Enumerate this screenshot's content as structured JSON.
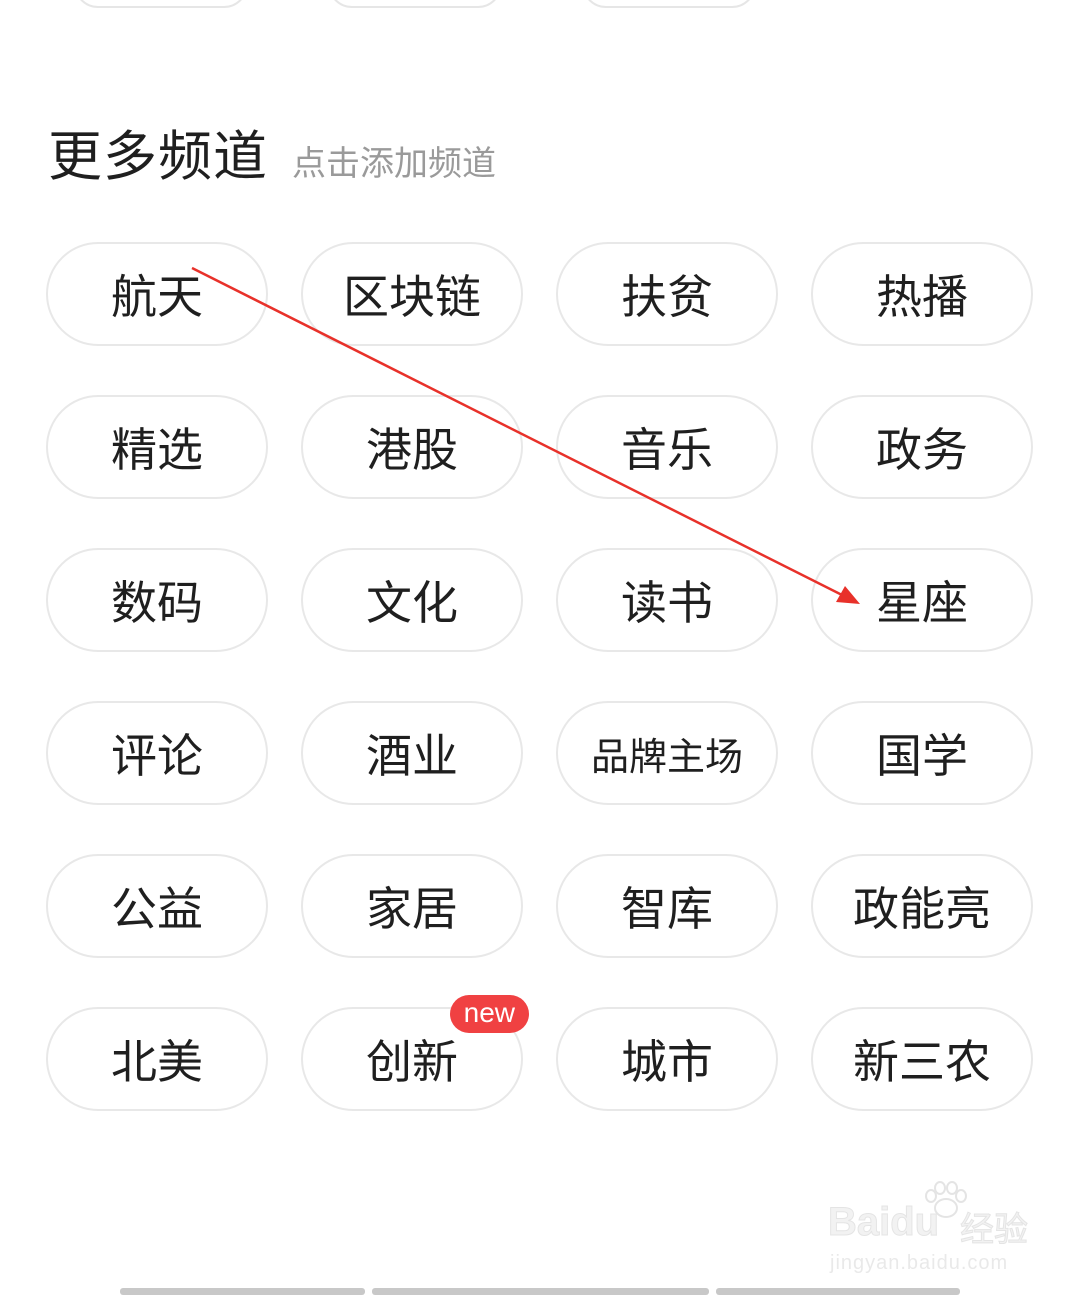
{
  "section": {
    "title": "更多频道",
    "hint": "点击添加频道"
  },
  "channels": [
    {
      "label": "航天"
    },
    {
      "label": "区块链"
    },
    {
      "label": "扶贫"
    },
    {
      "label": "热播"
    },
    {
      "label": "精选"
    },
    {
      "label": "港股"
    },
    {
      "label": "音乐"
    },
    {
      "label": "政务"
    },
    {
      "label": "数码"
    },
    {
      "label": "文化"
    },
    {
      "label": "读书"
    },
    {
      "label": "星座"
    },
    {
      "label": "评论"
    },
    {
      "label": "酒业"
    },
    {
      "label": "品牌主场"
    },
    {
      "label": "国学"
    },
    {
      "label": "公益"
    },
    {
      "label": "家居"
    },
    {
      "label": "智库"
    },
    {
      "label": "政能亮"
    },
    {
      "label": "北美"
    },
    {
      "label": "创新",
      "badge": "new"
    },
    {
      "label": "城市"
    },
    {
      "label": "新三农"
    }
  ],
  "annotation": {
    "from": "航天",
    "to": "星座",
    "color": "#e8312a"
  },
  "watermark": {
    "logo": "Baidu",
    "cn": "经验",
    "url": "jingyan.baidu.com"
  },
  "colors": {
    "badge": "#f04142",
    "chip_border": "#e8e8e8",
    "hint": "#9a9a9a"
  }
}
